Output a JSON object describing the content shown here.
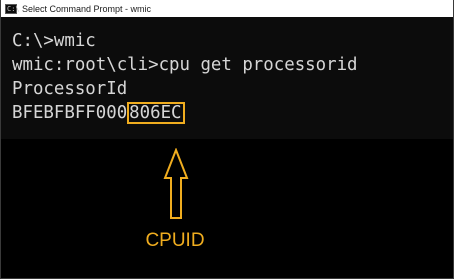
{
  "window": {
    "title": "Select Command Prompt - wmic",
    "icon": "cmd-icon"
  },
  "console": {
    "line1": "C:\\>wmic",
    "line2": "wmic:root\\cli>cpu get processorid",
    "line3": "ProcessorId",
    "line4_prefix": "BFEBFBFF000",
    "line4_highlight": "806EC"
  },
  "annotation": {
    "label": "CPUID",
    "icon": "up-arrow-icon",
    "color": "#f0ad1f"
  }
}
